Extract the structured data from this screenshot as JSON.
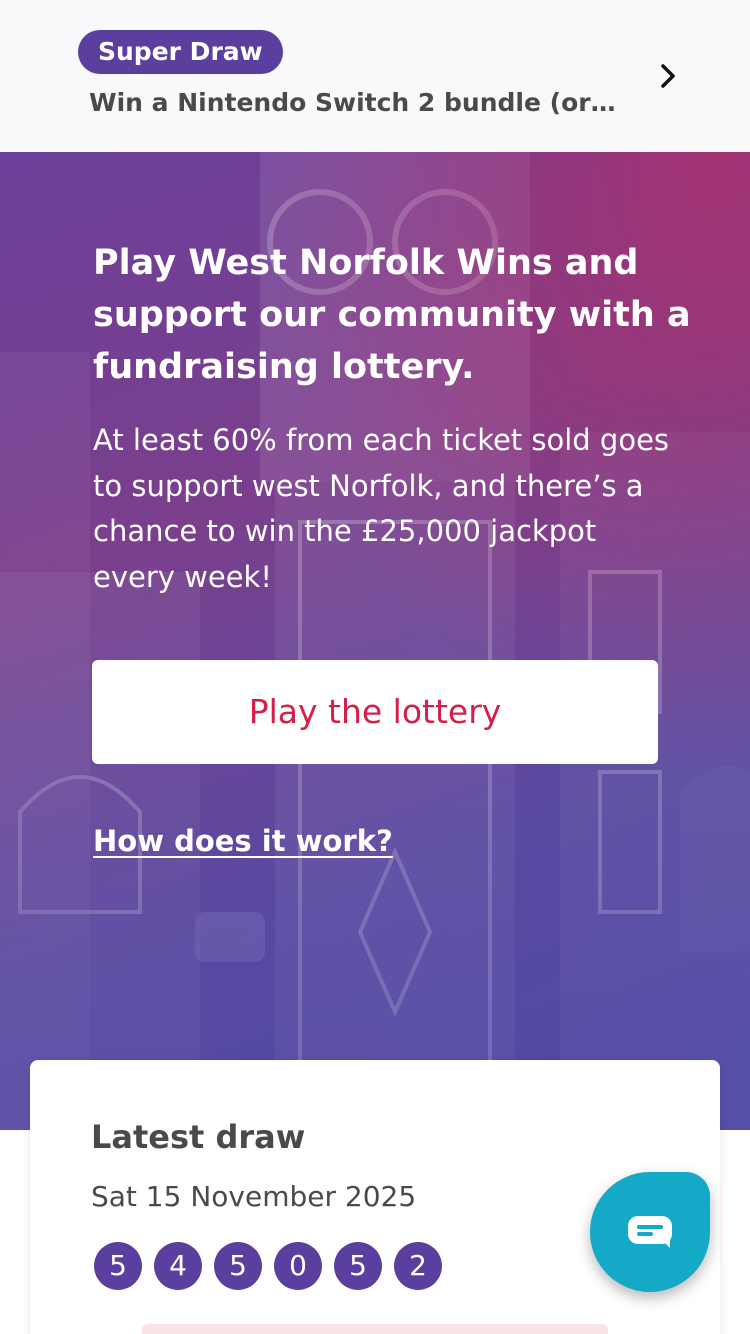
{
  "promo": {
    "badge": "Super Draw",
    "text": "Win a Nintendo Switch 2 bundle (or c...",
    "chevron_icon": "chevron-right-icon"
  },
  "hero": {
    "title": "Play West Norfolk Wins and support our community with a fundraising lottery.",
    "body": "At least 60% from each ticket sold goes to support west Norfolk, and there’s a chance to win the £25,000 jackpot every week!",
    "play_button_label": "Play the lottery",
    "how_link_label": "How does it work?"
  },
  "latest_draw": {
    "title": "Latest draw",
    "date": "Sat 15 November 2025",
    "numbers": [
      "5",
      "4",
      "5",
      "0",
      "5",
      "2"
    ]
  },
  "chat": {
    "icon": "chat-bubble-icon"
  },
  "colors": {
    "brand_purple": "#5a3f9e",
    "accent_red": "#d32048",
    "chat_teal": "#14a9c6"
  }
}
